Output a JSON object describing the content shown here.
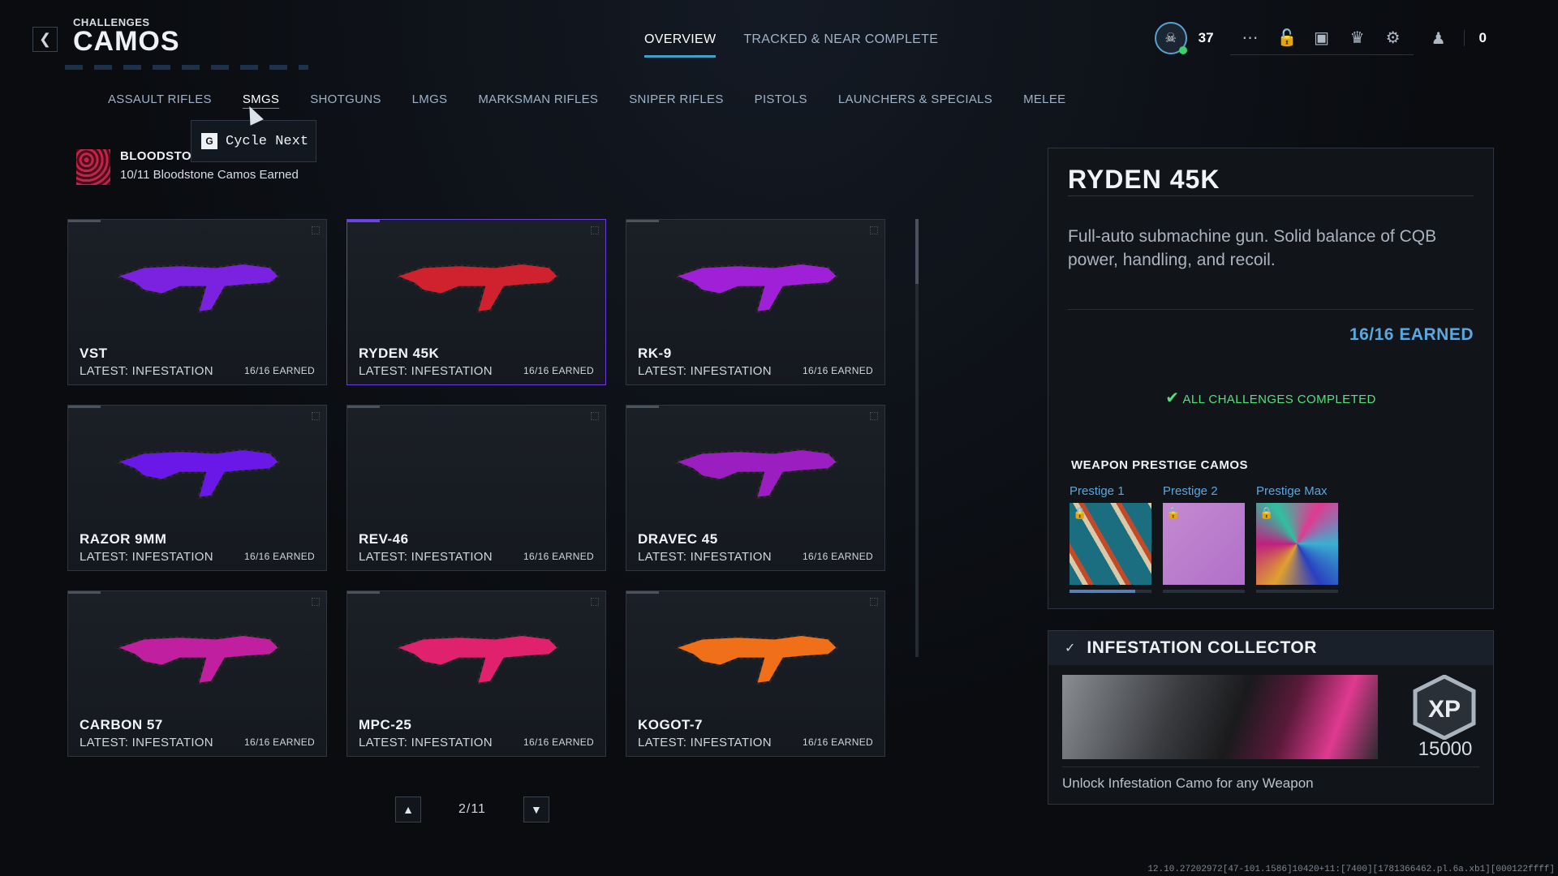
{
  "header": {
    "section": "CHALLENGES",
    "title": "CAMOS"
  },
  "top_tabs": [
    {
      "label": "OVERVIEW",
      "active": true
    },
    {
      "label": "TRACKED & NEAR COMPLETE",
      "active": false
    }
  ],
  "hud": {
    "rank": "37",
    "icons": [
      "grid-icon",
      "lock-icon",
      "camera-icon",
      "bell-icon",
      "gear-icon"
    ],
    "social_count": "0"
  },
  "category_tabs": [
    {
      "label": "ASSAULT RIFLES"
    },
    {
      "label": "SMGS",
      "active": true
    },
    {
      "label": "SHOTGUNS"
    },
    {
      "label": "LMGS"
    },
    {
      "label": "MARKSMAN RIFLES"
    },
    {
      "label": "SNIPER RIFLES"
    },
    {
      "label": "PISTOLS"
    },
    {
      "label": "LAUNCHERS & SPECIALS"
    },
    {
      "label": "MELEE"
    }
  ],
  "tooltip": {
    "key": "G",
    "label": "Cycle Next"
  },
  "bloodstone": {
    "title": "BLOODSTONE",
    "subtitle": "10/11 Bloodstone Camos Earned"
  },
  "weapons": [
    {
      "name": "VST",
      "latest": "LATEST: INFESTATION",
      "earned": "16/16 EARNED",
      "color": "#7a22e0"
    },
    {
      "name": "RYDEN 45K",
      "latest": "LATEST: INFESTATION",
      "earned": "16/16 EARNED",
      "color": "#d0222e",
      "selected": true
    },
    {
      "name": "RK-9",
      "latest": "LATEST: INFESTATION",
      "earned": "16/16 EARNED",
      "color": "#a020d8"
    },
    {
      "name": "RAZOR 9MM",
      "latest": "LATEST: INFESTATION",
      "earned": "16/16 EARNED",
      "color": "#6a18e8"
    },
    {
      "name": "REV-46",
      "latest": "LATEST: INFESTATION",
      "earned": "16/16 EARNED",
      "color": ""
    },
    {
      "name": "DRAVEC 45",
      "latest": "LATEST: INFESTATION",
      "earned": "16/16 EARNED",
      "color": "#9a1ec0"
    },
    {
      "name": "CARBON 57",
      "latest": "LATEST: INFESTATION",
      "earned": "16/16 EARNED",
      "color": "#c020a0"
    },
    {
      "name": "MPC-25",
      "latest": "LATEST: INFESTATION",
      "earned": "16/16 EARNED",
      "color": "#e0226e"
    },
    {
      "name": "KOGOT-7",
      "latest": "LATEST: INFESTATION",
      "earned": "16/16 EARNED",
      "color": "#f0701a"
    }
  ],
  "pager": {
    "text": "2/11"
  },
  "detail": {
    "title": "RYDEN 45K",
    "description": "Full-auto submachine gun. Solid balance of CQB power, handling, and recoil.",
    "earned": "16/16 EARNED",
    "all_challenges": "ALL CHALLENGES COMPLETED",
    "prestige_title": "WEAPON PRESTIGE CAMOS",
    "prestige": [
      {
        "label": "Prestige 1",
        "progress": 0.8
      },
      {
        "label": "Prestige 2",
        "progress": 0
      },
      {
        "label": "Prestige Max",
        "progress": 0
      }
    ]
  },
  "collector": {
    "title": "INFESTATION COLLECTOR",
    "xp_label": "XP",
    "xp_value": "15000",
    "description": "Unlock Infestation Camo for any Weapon"
  },
  "build_info": "12.10.27202972[47-101.1586]10420+11:[7400][1781366462.pl.6a.xb1][000122ffff]"
}
